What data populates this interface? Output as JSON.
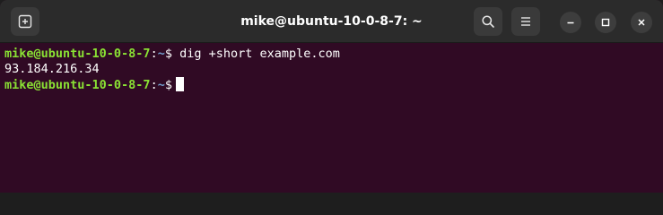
{
  "window": {
    "title": "mike@ubuntu-10-0-8-7: ~"
  },
  "titlebar": {
    "new_tab_icon": "new-tab-icon",
    "search_icon": "search-icon",
    "menu_icon": "hamburger-menu-icon",
    "minimize_icon": "minimize-icon",
    "maximize_icon": "maximize-icon",
    "close_icon": "close-icon"
  },
  "terminal": {
    "prompt_user": "mike@ubuntu-10-0-8-7",
    "prompt_colon": ":",
    "prompt_path": "~",
    "prompt_dollar": "$",
    "lines": [
      {
        "command": " dig +short example.com"
      },
      {
        "output": "93.184.216.34"
      },
      {
        "command": " "
      }
    ]
  },
  "colors": {
    "background": "#300a24",
    "titlebar": "#2b2b2b",
    "prompt_user": "#8ae234",
    "prompt_path": "#729fcf",
    "text": "#ffffff"
  }
}
